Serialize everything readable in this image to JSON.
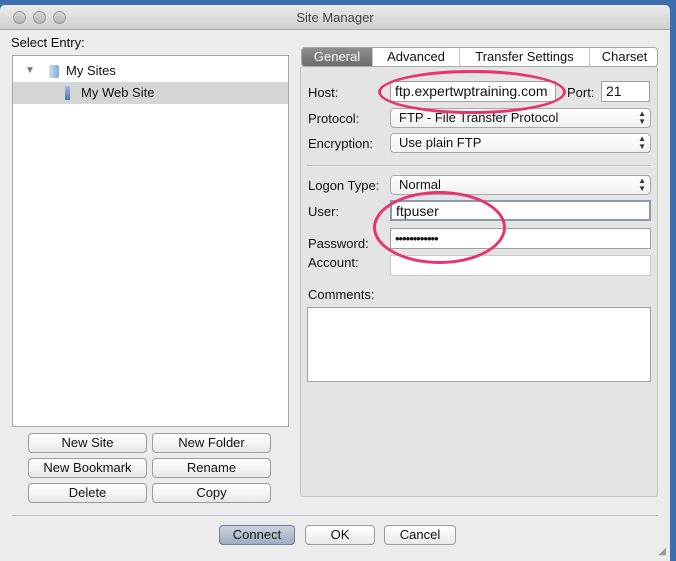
{
  "window": {
    "title": "Site Manager"
  },
  "left": {
    "label": "Select Entry:",
    "tree": [
      {
        "label": "My Sites",
        "icon": "folder-icon",
        "expanded": true
      },
      {
        "label": "My Web Site",
        "icon": "server-icon",
        "selected": true
      }
    ],
    "buttons": {
      "new_site": "New Site",
      "new_folder": "New Folder",
      "new_bookmark": "New Bookmark",
      "rename": "Rename",
      "delete": "Delete",
      "copy": "Copy"
    }
  },
  "tabs": [
    "General",
    "Advanced",
    "Transfer Settings",
    "Charset"
  ],
  "general": {
    "host_label": "Host:",
    "host": "ftp.expertwptraining.com",
    "port_label": "Port:",
    "port": "21",
    "protocol_label": "Protocol:",
    "protocol": "FTP - File Transfer Protocol",
    "encryption_label": "Encryption:",
    "encryption": "Use plain FTP",
    "logon_label": "Logon Type:",
    "logon": "Normal",
    "user_label": "User:",
    "user": "ftpuser",
    "password_label": "Password:",
    "password": "••••••••••••",
    "account_label": "Account:",
    "account": "",
    "comments_label": "Comments:",
    "comments": ""
  },
  "footer": {
    "connect": "Connect",
    "ok": "OK",
    "cancel": "Cancel"
  },
  "colors": {
    "highlight": "#e8336e"
  }
}
